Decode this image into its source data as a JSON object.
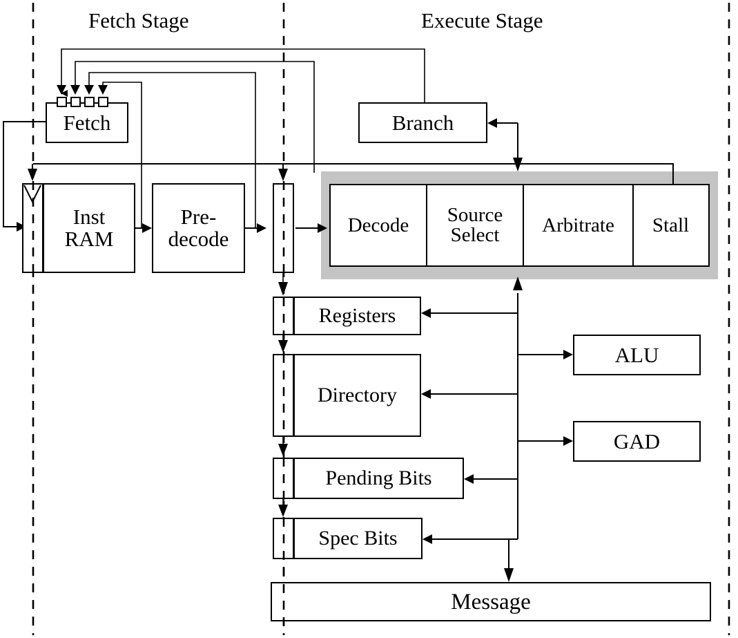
{
  "diagram": {
    "title_fetch_stage": "Fetch Stage",
    "title_execute_stage": "Execute Stage",
    "blocks": {
      "fetch": "Fetch",
      "inst_ram": "Inst\nRAM",
      "inst_ram_line1": "Inst",
      "inst_ram_line2": "RAM",
      "predecode_line1": "Pre-",
      "predecode_line2": "decode",
      "branch": "Branch",
      "registers": "Registers",
      "directory": "Directory",
      "pending_bits": "Pending Bits",
      "spec_bits": "Spec Bits",
      "alu": "ALU",
      "gad": "GAD",
      "message": "Message"
    },
    "pipeline": {
      "cells": [
        {
          "label": "Decode",
          "lines": [
            "Decode"
          ]
        },
        {
          "label": "Source Select",
          "lines": [
            "Source",
            "Select"
          ]
        },
        {
          "label": "Arbitrate",
          "lines": [
            "Arbitrate"
          ]
        },
        {
          "label": "Stall",
          "lines": [
            "Stall"
          ]
        }
      ]
    },
    "colors": {
      "line": "#000000",
      "pipeline_highlight": "#c4c4c4",
      "background": "#ffffff"
    }
  }
}
